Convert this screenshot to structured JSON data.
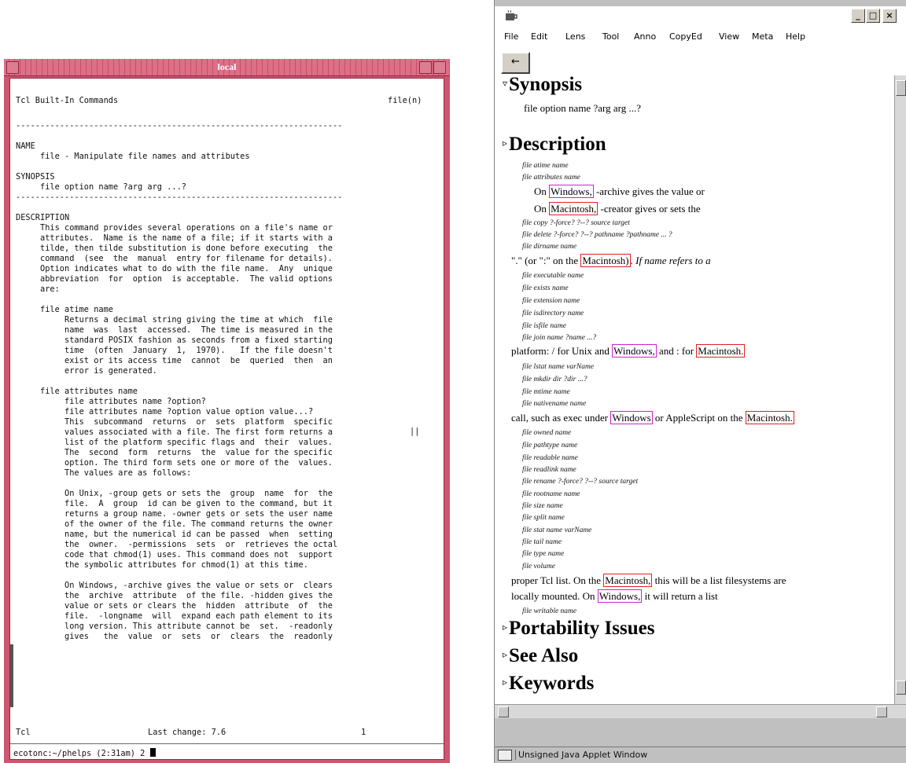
{
  "terminal": {
    "title": "local",
    "header_left": "Tcl Built-In Commands",
    "header_right": "file(n)",
    "rule": "-------------------------------------------------------------------",
    "lines": [
      "NAME",
      "     file - Manipulate file names and attributes",
      "",
      "SYNOPSIS",
      "     file option name ?arg arg ...?",
      "-------------------------------------------------------------------",
      "",
      "DESCRIPTION",
      "     This command provides several operations on a file's name or",
      "     attributes.  Name is the name of a file; if it starts with a",
      "     tilde, then tilde substitution is done before executing  the",
      "     command  (see  the  manual  entry for filename for details).",
      "     Option indicates what to do with the file name.  Any  unique",
      "     abbreviation  for  option  is acceptable.  The valid options",
      "     are:",
      "",
      "     file atime name",
      "          Returns a decimal string giving the time at which  file",
      "          name  was  last  accessed.  The time is measured in the",
      "          standard POSIX fashion as seconds from a fixed starting",
      "          time  (often  January  1,  1970).   If the file doesn't",
      "          exist or its access time  cannot  be  queried  then  an",
      "          error is generated.",
      "",
      "     file attributes name",
      "          file attributes name ?option?",
      "          file attributes name ?option value option value...?",
      "          This  subcommand  returns  or  sets  platform  specific",
      "          values associated with a file. The first form returns a",
      "          list of the platform specific flags and  their  values.",
      "          The  second  form  returns  the  value for the specific",
      "          option. The third form sets one or more of the  values.",
      "          The values are as follows:",
      "",
      "          On Unix, -group gets or sets the  group  name  for  the",
      "          file.  A  group  id can be given to the command, but it",
      "          returns a group name. -owner gets or sets the user name",
      "          of the owner of the file. The command returns the owner",
      "          name, but the numerical id can be passed  when  setting",
      "          the  owner.  -permissions  sets  or  retrieves the octal",
      "          code that chmod(1) uses. This command does not  support",
      "          the symbolic attributes for chmod(1) at this time.",
      "",
      "          On Windows, -archive gives the value or sets or  clears",
      "          the  archive  attribute  of the file. -hidden gives the",
      "          value or sets or clears the  hidden  attribute  of  the",
      "          file.  -longname  will  expand each path element to its",
      "          long version. This attribute cannot be  set.  -readonly",
      "          gives   the  value  or  sets  or  clears  the  readonly"
    ],
    "side_mark": "||",
    "footer_left": "Tcl",
    "footer_center": "Last change: 7.6",
    "footer_right": "1",
    "prompt": "ecotonc:~/phelps (2:31am) 2 "
  },
  "applet": {
    "window_buttons": [
      "_",
      "□",
      "×"
    ],
    "menu": [
      "File",
      "Edit",
      "Lens",
      "Tool",
      "Anno",
      "CopyEd",
      "View",
      "Meta",
      "Help"
    ],
    "back_button": "←",
    "sections": {
      "synopsis": "Synopsis",
      "description": "Description",
      "portability": "Portability Issues",
      "see_also": "See Also",
      "keywords": "Keywords"
    },
    "synopsis_text": "file option name ?arg arg ...?",
    "items": {
      "i1": "file atime name",
      "i2": "file attributes name",
      "i3": "file copy ?-force? ?--? source target",
      "i4": "file delete ?-force? ?--? pathname ?pathname ... ?",
      "i5": "file dirname name",
      "i6": "file executable name",
      "i7": "file exists name",
      "i8": "file extension name",
      "i9": "file isdirectory name",
      "i10": "file isfile name",
      "i11": "file join name ?name ...?",
      "i12": "file lstat name varName",
      "i13": "file mkdir dir ?dir ...?",
      "i14": "file mtime name",
      "i15": "file nativename name",
      "i16": "file owned name",
      "i17": "file pathtype name",
      "i18": "file readable name",
      "i19": "file readlink name",
      "i20": "file rename ?-force? ?--? source target",
      "i21": "file rootname name",
      "i22": "file size name",
      "i23": "file split name",
      "i24": "file stat name varName",
      "i25": "file tail name",
      "i26": "file type name",
      "i27": "file volume",
      "i28": "file writable name"
    },
    "p": {
      "win1_a": "On ",
      "win1_link": "Windows,",
      "win1_b": " -archive gives the value or",
      "mac1_a": "On ",
      "mac1_link": "Macintosh,",
      "mac1_b": " -creator gives or sets the",
      "dir_a": "\".\" (or \":\" on the ",
      "dir_link": "Macintosh)",
      "dir_b": ". If name refers to a",
      "plat_a": "platform: / for Unix and ",
      "plat_link1": "Windows,",
      "plat_b": " and : for ",
      "plat_link2": "Macintosh.",
      "call_a": "call, such as exec under ",
      "call_link1": "Windows",
      "call_b": " or AppleScript on the ",
      "call_link2": "Macintosh.",
      "prop_a": "proper Tcl list. On the ",
      "prop_link": "Macintosh,",
      "prop_b": " this will be a list filesystems are",
      "loc_a": "locally mounted. On ",
      "loc_link": "Windows,",
      "loc_b": " it will return a list"
    },
    "status_text": "Unsigned Java Applet Window"
  }
}
